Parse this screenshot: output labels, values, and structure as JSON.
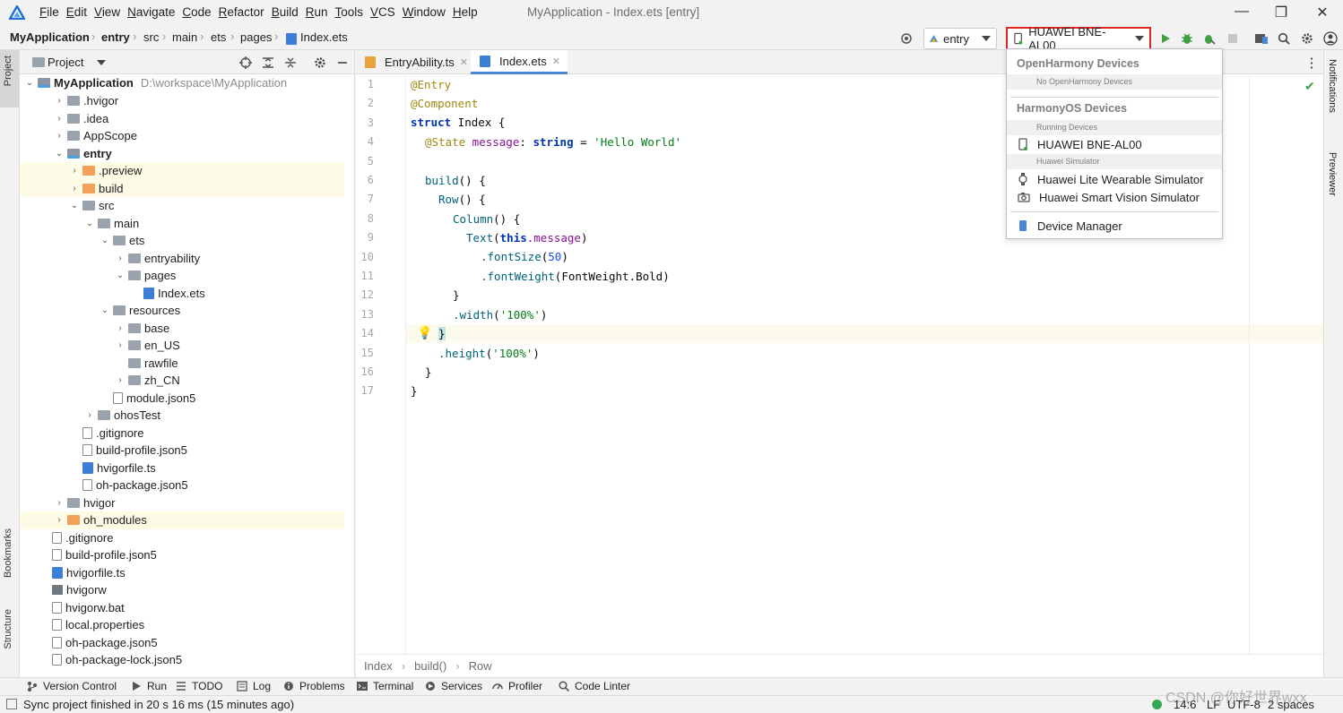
{
  "menubar": {
    "items": [
      "File",
      "Edit",
      "View",
      "Navigate",
      "Code",
      "Refactor",
      "Build",
      "Run",
      "Tools",
      "VCS",
      "Window",
      "Help"
    ],
    "window_title": "MyApplication - Index.ets [entry]",
    "minimize": "—",
    "restore": "❐",
    "close": "✕"
  },
  "navbar": {
    "crumbs": [
      "MyApplication",
      "entry",
      "src",
      "main",
      "ets",
      "pages",
      "Index.ets"
    ],
    "module_selector": "entry",
    "device_selector": "HUAWEI BNE-AL00",
    "accent_color": "#e0261f"
  },
  "left_stripe": {
    "project": "Project",
    "bookmarks": "Bookmarks",
    "structure": "Structure"
  },
  "project_panel": {
    "title": "Project",
    "root_name": "MyApplication",
    "root_path": "D:\\workspace\\MyApplication",
    "tree": [
      {
        "label": ".hvigor",
        "icon": "folder",
        "arrow": "›"
      },
      {
        "label": ".idea",
        "icon": "folder",
        "arrow": "›"
      },
      {
        "label": "AppScope",
        "icon": "folder",
        "arrow": "›"
      },
      {
        "label": "entry",
        "icon": "module",
        "arrow": "⌄"
      },
      {
        "label": ".preview",
        "icon": "orange",
        "arrow": "›"
      },
      {
        "label": "build",
        "icon": "orange",
        "arrow": "›"
      },
      {
        "label": "src",
        "icon": "folder",
        "arrow": "⌄"
      },
      {
        "label": "main",
        "icon": "folder",
        "arrow": "⌄"
      },
      {
        "label": "ets",
        "icon": "folder",
        "arrow": "⌄"
      },
      {
        "label": "entryability",
        "icon": "folder",
        "arrow": "›"
      },
      {
        "label": "pages",
        "icon": "folder",
        "arrow": "⌄"
      },
      {
        "label": "Index.ets",
        "icon": "ts",
        "arrow": ""
      },
      {
        "label": "resources",
        "icon": "folder",
        "arrow": "⌄"
      },
      {
        "label": "base",
        "icon": "folder",
        "arrow": "›"
      },
      {
        "label": "en_US",
        "icon": "folder",
        "arrow": "›"
      },
      {
        "label": "rawfile",
        "icon": "folder",
        "arrow": ""
      },
      {
        "label": "zh_CN",
        "icon": "folder",
        "arrow": "›"
      },
      {
        "label": "module.json5",
        "icon": "file",
        "arrow": ""
      },
      {
        "label": "ohosTest",
        "icon": "folder",
        "arrow": "›"
      },
      {
        "label": ".gitignore",
        "icon": "file",
        "arrow": ""
      },
      {
        "label": "build-profile.json5",
        "icon": "file",
        "arrow": ""
      },
      {
        "label": "hvigorfile.ts",
        "icon": "ts",
        "arrow": ""
      },
      {
        "label": "oh-package.json5",
        "icon": "file",
        "arrow": ""
      },
      {
        "label": "hvigor",
        "icon": "folder",
        "arrow": "›"
      },
      {
        "label": "oh_modules",
        "icon": "orange",
        "arrow": "›"
      },
      {
        "label": ".gitignore",
        "icon": "file",
        "arrow": ""
      },
      {
        "label": "build-profile.json5",
        "icon": "file",
        "arrow": ""
      },
      {
        "label": "hvigorfile.ts",
        "icon": "ts",
        "arrow": ""
      },
      {
        "label": "hvigorw",
        "icon": "term",
        "arrow": ""
      },
      {
        "label": "hvigorw.bat",
        "icon": "file",
        "arrow": ""
      },
      {
        "label": "local.properties",
        "icon": "file",
        "arrow": ""
      },
      {
        "label": "oh-package.json5",
        "icon": "file",
        "arrow": ""
      },
      {
        "label": "oh-package-lock.json5",
        "icon": "file",
        "arrow": ""
      }
    ]
  },
  "editor": {
    "tabs": [
      {
        "label": "EntryAbility.ts",
        "close": "✕"
      },
      {
        "label": "Index.ets",
        "close": "✕"
      }
    ],
    "line_numbers": [
      "1",
      "2",
      "3",
      "4",
      "5",
      "6",
      "7",
      "8",
      "9",
      "10",
      "11",
      "12",
      "13",
      "14",
      "15",
      "16",
      "17"
    ],
    "code": {
      "l1": "@Entry",
      "l2": "@Component",
      "l3_kw": "struct",
      "l3_name": " Index {",
      "l4_ann": "@State",
      "l4_prop": " message",
      "l4_mid": ": ",
      "l4_type": "string",
      "l4_eq": " = ",
      "l4_str": "'Hello World'",
      "l6_fn": "build",
      "l6_rest": "() {",
      "l7_fn": "Row",
      "l7_rest": "() {",
      "l8_fn": "Column",
      "l8_rest": "() {",
      "l9_fn": "Text",
      "l9_open": "(",
      "l9_kw": "this",
      "l9_prop": ".message",
      "l9_close": ")",
      "l10_fn": ".fontSize",
      "l10_open": "(",
      "l10_num": "50",
      "l10_close": ")",
      "l11_fn": ".fontWeight",
      "l11_arg": "(FontWeight.Bold)",
      "l12": "}",
      "l13_fn": ".width",
      "l13_open": "(",
      "l13_str": "'100%'",
      "l13_close": ")",
      "l14": "}",
      "l15_fn": ".height",
      "l15_open": "(",
      "l15_str": "'100%'",
      "l15_close": ")",
      "l16": "}",
      "l17": "}"
    },
    "breadcrumb": [
      "Index",
      "build()",
      "Row"
    ]
  },
  "right_stripe": {
    "notifications": "Notifications",
    "previewer": "Previewer"
  },
  "device_dropdown": {
    "openharmony_header": "OpenHarmony Devices",
    "no_openharmony": "No OpenHarmony Devices",
    "harmonyos_header": "HarmonyOS Devices",
    "running_devices": "Running Devices",
    "running_device": "HUAWEI BNE-AL00",
    "simulator_group": "Huawei Simulator",
    "simulators": [
      "Huawei Lite Wearable Simulator",
      "Huawei Smart Vision Simulator"
    ],
    "device_manager": "Device Manager"
  },
  "tool_windows": [
    "Version Control",
    "Run",
    "TODO",
    "Log",
    "Problems",
    "Terminal",
    "Services",
    "Profiler",
    "Code Linter"
  ],
  "status": {
    "message": "Sync project finished in 20 s 16 ms (15 minutes ago)",
    "position": "14:6",
    "line_sep": "LF",
    "encoding": "UTF-8",
    "indent": "2 spaces",
    "watermark": "CSDN @你好世界wxx"
  }
}
